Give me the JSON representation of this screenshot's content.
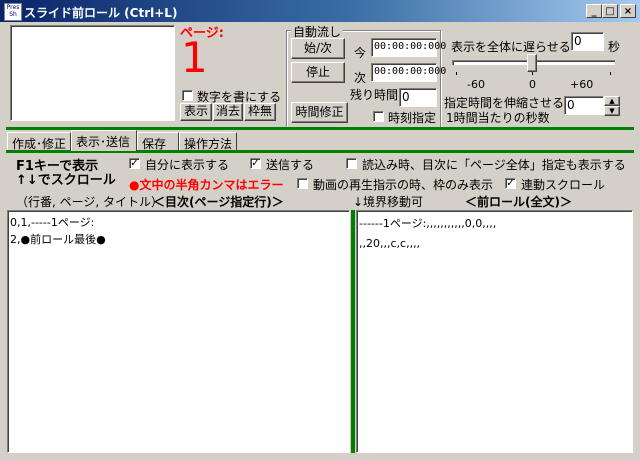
{
  "window": {
    "icon_text": "Pres Sh",
    "title": "スライド前ロール (Ctrl+L)",
    "controls": {
      "minimize": "_",
      "maximize": "□",
      "close": "×"
    }
  },
  "page_indicator": {
    "label": "ページ:",
    "number": "1",
    "write_number_label": "数字を書にする",
    "buttons": {
      "show": "表示",
      "erase": "消去",
      "frame": "枠無"
    }
  },
  "auto_flow": {
    "group_label": "自動流し",
    "start_next": "始/次",
    "stop": "停止",
    "time_fix": "時間修正",
    "now_label": "今",
    "now_value": "00:00:00:000",
    "next_label": "次",
    "next_value": "00:00:00:000",
    "remaining_label": "残り時間",
    "remaining_value": "0",
    "time_specify_label": "時刻指定"
  },
  "delay": {
    "label": "表示を全体に遅らせる",
    "value": "0",
    "unit": "秒",
    "slider_ticks": [
      "-60",
      "0",
      "+60"
    ],
    "slider_value": 0,
    "stretch_label_1": "指定時間を伸縮させる",
    "stretch_label_2": "1時間当たりの秒数",
    "stretch_value": "0"
  },
  "accent_color": "#008000",
  "tabs": [
    "作成･修正",
    "表示･送信",
    "保存",
    "操作方法"
  ],
  "active_tab": 1,
  "panel": {
    "f1_line1": "F1キーで表示",
    "f1_line2": "↑↓でスクロール",
    "auto_show": "自分に表示する",
    "send": "送信する",
    "show_toc_on_load": "読込み時、目次に「ページ全体」指定も表示する",
    "comma_error": "●文中の半角カンマはエラー",
    "frame_only": "動画の再生指示の時、枠のみ表示",
    "linked_scroll": "連動スクロール",
    "left_caption": "（行番, ページ, タイトル）",
    "left_header": "＜目次(ページ指定行)＞",
    "border_move": "↓境界移動可",
    "right_header": "＜前ロール(全文)＞",
    "error_color": "#ff0000"
  },
  "toc_lines": [
    "0,1,-----1ページ:",
    "2,●前ロール最後●"
  ],
  "full_text_lines": [
    "------1ページ:,,,,,,,,,,,0,0,,,,",
    ",,20,,,c,c,,,,"
  ]
}
